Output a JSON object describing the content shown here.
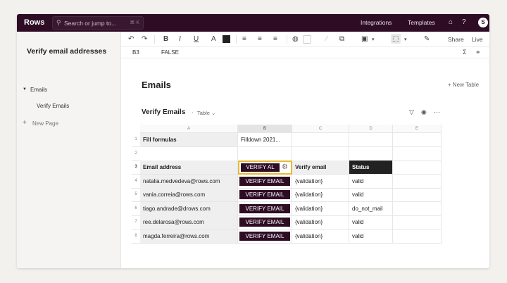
{
  "topbar": {
    "logo": "Rows",
    "search_placeholder": "Search or jump to...",
    "search_shortcut": "⌘ K",
    "integrations": "Integrations",
    "templates": "Templates",
    "avatar_initial": "S"
  },
  "sidebar": {
    "doc_title": "Verify email addresses",
    "section": "Emails",
    "page": "Verify Emails",
    "new_page": "New Page"
  },
  "toolbar": {
    "share": "Share",
    "live": "Live",
    "swatch_color": "#222222"
  },
  "formula_bar": {
    "cell_ref": "B3",
    "value": "FALSE"
  },
  "main": {
    "page_title": "Emails",
    "new_table": "+ New Table",
    "table_title": "Verify Emails",
    "table_kind": "Table"
  },
  "grid": {
    "columns": [
      "A",
      "B",
      "C",
      "D",
      "E"
    ],
    "rows": [
      "1",
      "2",
      "3",
      "4",
      "5",
      "6",
      "7",
      "8"
    ],
    "a1": "Fill formulas",
    "b1": "Filldown 2021...",
    "headers": {
      "email": "Email address",
      "verify_button": "VERIFY AL",
      "verify": "Verify email",
      "status": "Status"
    },
    "data": [
      {
        "email": "natalia.medvedeva@rows.com",
        "button": "VERIFY EMAIL",
        "verify": "{validation}",
        "status": "valid"
      },
      {
        "email": "vania.correia@rows.com",
        "button": "VERIFY EMAIL",
        "verify": "{validation}",
        "status": "valid"
      },
      {
        "email": "tiago.andrade@drows.com",
        "button": "VERIFY EMAIL",
        "verify": "{validation}",
        "status": "do_not_mail"
      },
      {
        "email": "ree.delarosa@rows.com",
        "button": "VERIFY EMAIL",
        "verify": "{validation}",
        "status": "valid"
      },
      {
        "email": "magda.ferreira@rows.com",
        "button": "VERIFY EMAIL",
        "verify": "{validation}",
        "status": "valid"
      }
    ]
  },
  "colors": {
    "brand": "#2d0c24",
    "selection": "#e8b931"
  }
}
